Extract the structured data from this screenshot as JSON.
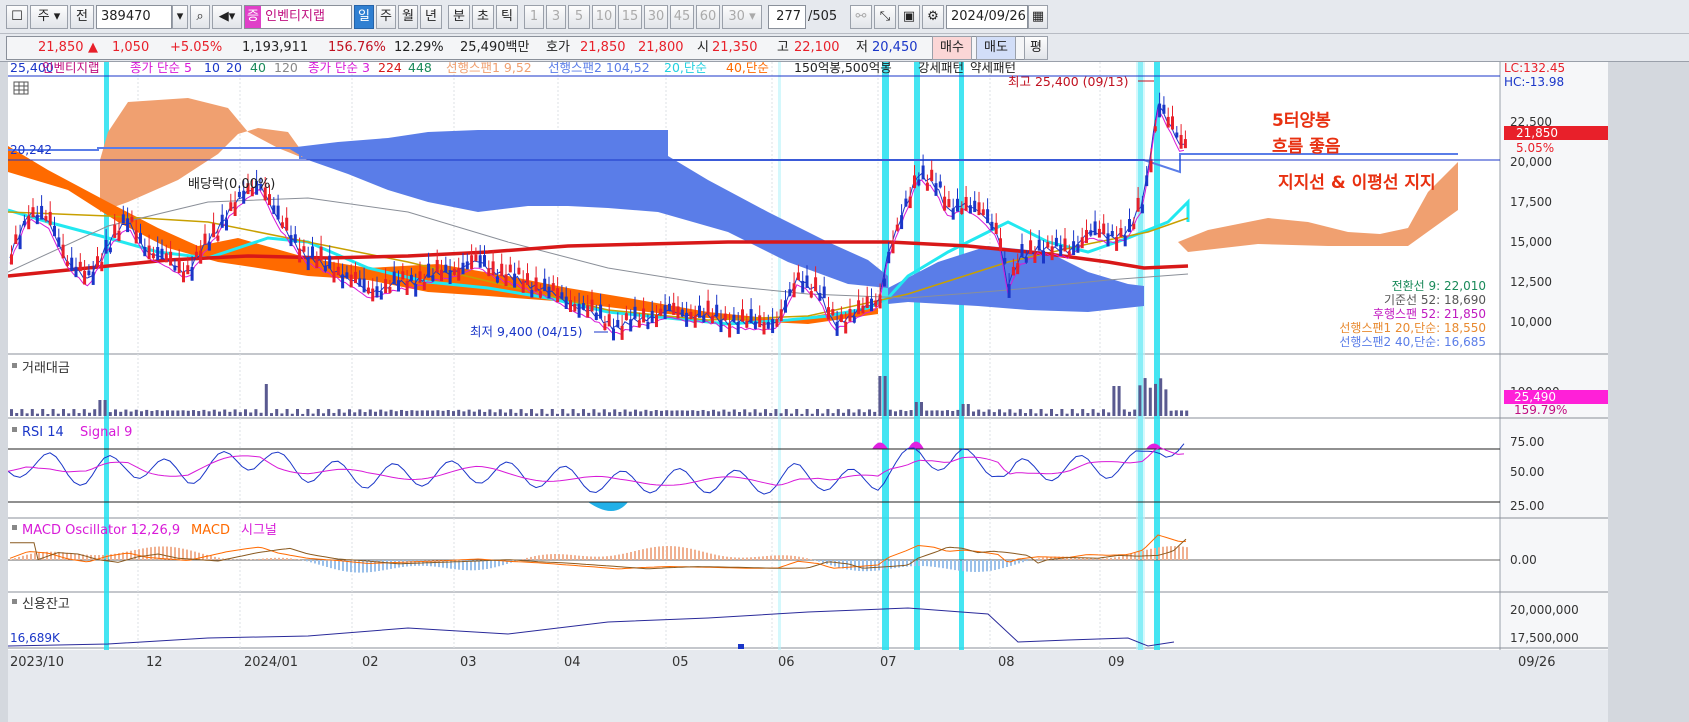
{
  "toolbar": {
    "market": "주",
    "period_mode": "전",
    "code": "389470",
    "stock_name": "인벤티지랩",
    "badge": "증",
    "periods": [
      "일",
      "주",
      "월",
      "년",
      "분",
      "초",
      "틱"
    ],
    "selected_period": "일",
    "numbers": [
      "1",
      "3",
      "5",
      "10",
      "15",
      "30",
      "45",
      "60"
    ],
    "dropdown_value": "30",
    "count": "277",
    "total": "/505",
    "date": "2024/09/26"
  },
  "quote": {
    "price": "21,850",
    "change_arrow": "▲",
    "change": "1,050",
    "change_pct": "+5.05%",
    "volume": "1,193,911",
    "vol_ratio": "156.76%",
    "turnover": "12.29%",
    "amount": "25,490백만",
    "bid_label": "호가",
    "ask": "21,850",
    "bid": "21,800",
    "open_label": "시",
    "open": "21,350",
    "high_label": "고",
    "high": "22,100",
    "low_label": "저",
    "low": "20,450",
    "buy": "매수",
    "sell": "매도",
    "eval": "평"
  },
  "legend": {
    "prefix": "25,400",
    "name": "인벤티지랩",
    "ma1": "종가 단순 5",
    "ma_periods": [
      "10",
      "20",
      "40",
      "120"
    ],
    "ma2": "종가 단순 3",
    "ma2_periods": [
      "224",
      "448"
    ],
    "span1": "선행스팬1 9,52",
    "span2": "선행스팬2 104,52",
    "d20": "20,단순",
    "d40": "40,단순",
    "pat": "150억봉,500억봉",
    "strong": "강세패턴",
    "weak": "약세패턴"
  },
  "annotations": {
    "ex_div": "배당락(0.00%)",
    "high": "최고 25,400 (09/13)",
    "low": "최저 9,400 (04/15)",
    "left_level": "20,242",
    "note1": "5터양봉",
    "note2": "흐름 좋음",
    "note3": "지지선 & 이평선 지지"
  },
  "price_axis": {
    "lc": "LC:132.45",
    "hc": "HC:-13.98",
    "ticks": [
      "22,500",
      "20,000",
      "17,500",
      "15,000",
      "12,500",
      "10,000"
    ],
    "current": "21,850",
    "current_pct": "5.05%"
  },
  "indicator_values": [
    "전환선 9: 22,010",
    "기준선 52: 18,690",
    "후행스팬 52: 21,850",
    "선행스팬1 20,단순: 18,550",
    "선행스팬2 40,단순: 16,685"
  ],
  "panels": {
    "amount": {
      "title": "거래대금",
      "tick": "100,000",
      "value": "25,490",
      "value_pct": "159.79%"
    },
    "rsi": {
      "title": "RSI 14",
      "signal": "Signal 9",
      "ticks": [
        "75.00",
        "50.00",
        "25.00"
      ]
    },
    "macd": {
      "title": "MACD Oscillator 12,26,9",
      "macd": "MACD",
      "signal": "시그널",
      "tick": "0.00"
    },
    "credit": {
      "title": "신용잔고",
      "left": "16,689K",
      "ticks": [
        "20,000,000",
        "17,500,000"
      ]
    }
  },
  "xaxis": {
    "labels": [
      "2023/10",
      "12",
      "2024/01",
      "02",
      "03",
      "04",
      "05",
      "06",
      "07",
      "08",
      "09"
    ],
    "end": "09/26"
  },
  "colors": {
    "up": "#e8202a",
    "down": "#1a36c8",
    "cloud_up": "#f0a070",
    "cloud_down": "#5a7de8",
    "highlight": "#23e0f0",
    "ma_thick": "#d81818",
    "cyan": "#22e8f0",
    "magenta": "#d81ad8",
    "orange": "#ff6a00"
  }
}
